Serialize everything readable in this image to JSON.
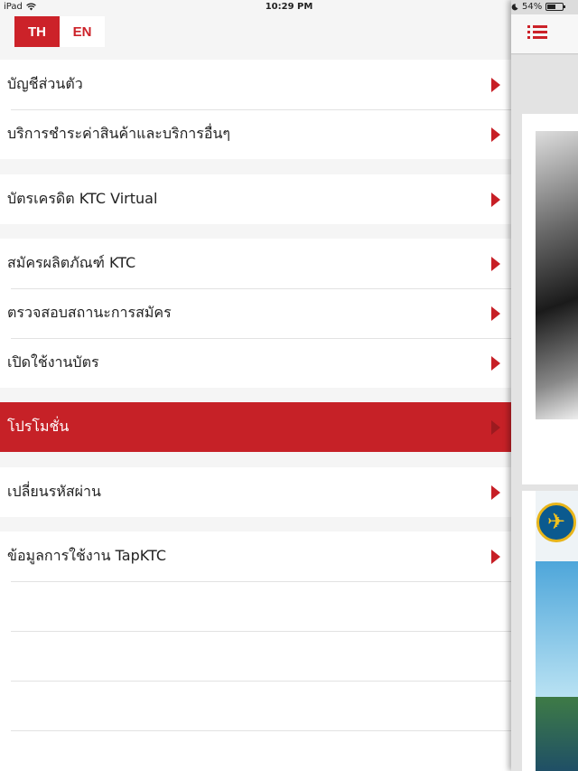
{
  "status_bar": {
    "device": "iPad",
    "wifi_icon": "wifi-icon",
    "time": "10:29 PM",
    "battery_percent": "54%"
  },
  "language": {
    "th_label": "TH",
    "en_label": "EN",
    "selected": "TH"
  },
  "menu": {
    "groups": [
      {
        "items": [
          {
            "label": "บัญชีส่วนตัว"
          },
          {
            "label": "บริการชำระค่าสินค้าและบริการอื่นๆ"
          }
        ]
      },
      {
        "items": [
          {
            "label": "บัตรเครดิต KTC Virtual"
          }
        ]
      },
      {
        "items": [
          {
            "label": "สมัครผลิตภัณฑ์ KTC"
          },
          {
            "label": "ตรวจสอบสถานะการสมัคร"
          },
          {
            "label": "เปิดใช้งานบัตร"
          }
        ]
      },
      {
        "items": [
          {
            "label": "โปรโมชั่น",
            "selected": true
          }
        ]
      },
      {
        "items": [
          {
            "label": "เปลี่ยนรหัสผ่าน"
          }
        ]
      },
      {
        "items": [
          {
            "label": "ข้อมูลการใช้งาน TapKTC"
          }
        ]
      }
    ]
  },
  "colors": {
    "brand_red": "#cc2229",
    "selected_row": "#c62127",
    "arrow": "#c71f26"
  },
  "icons": {
    "menu": "hamburger-icon",
    "row_arrow": "chevron-right-icon"
  }
}
